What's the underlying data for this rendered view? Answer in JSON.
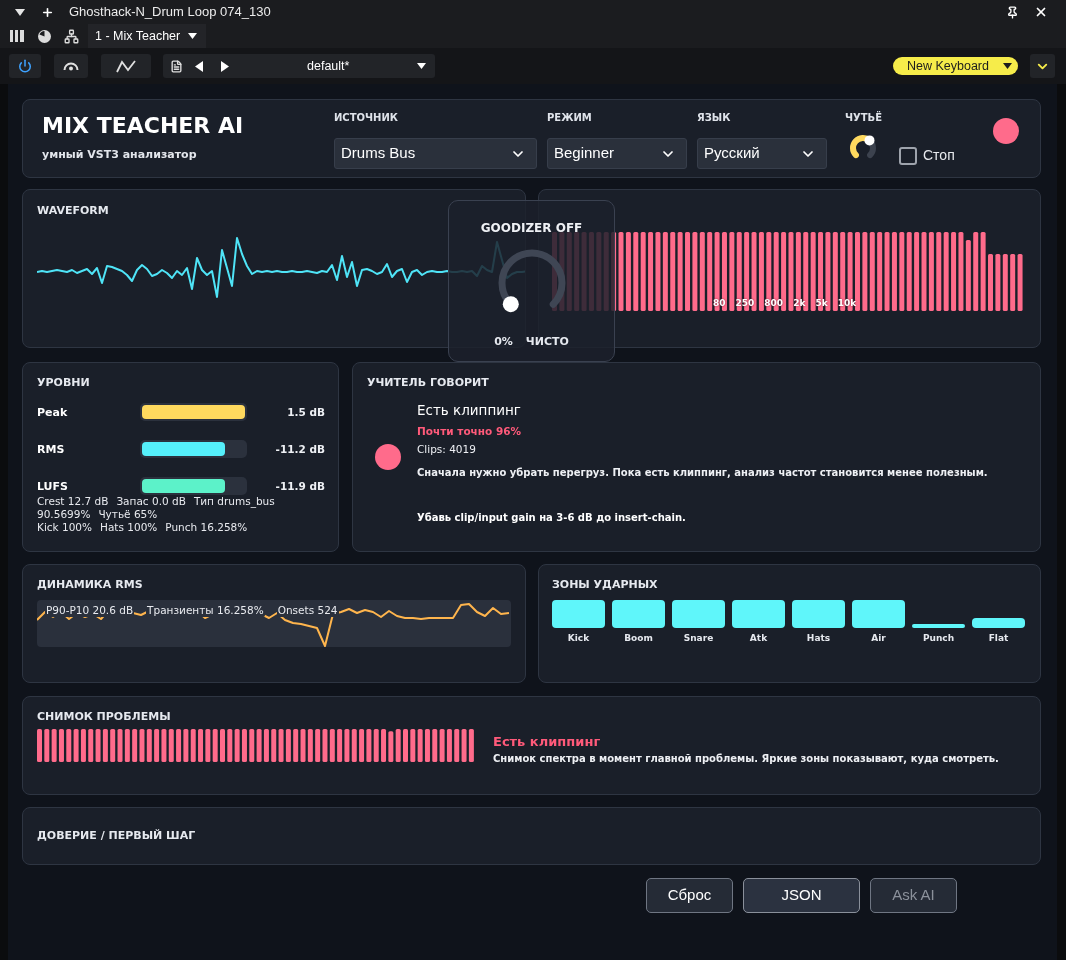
{
  "host": {
    "title": "Ghosthack-N_Drum Loop 074_130",
    "tab": "1 - Mix Teacher",
    "power_on": true,
    "preset": "default*",
    "keyboard": "New Keyboard"
  },
  "header": {
    "title": "MIX TEACHER AI",
    "subtitle": "умный VST3 анализатор",
    "selects": [
      {
        "label": "ИСТОЧНИК",
        "value": "Drums Bus"
      },
      {
        "label": "РЕЖИМ",
        "value": "Beginner"
      },
      {
        "label": "ЯЗЫК",
        "value": "Русский"
      }
    ],
    "sensitivity": {
      "label": "ЧУТЬЁ"
    },
    "stop": {
      "label": "Стоп",
      "checked": false
    }
  },
  "waveform": {
    "title": "WAVEFORM"
  },
  "spectrum": {
    "freq_labels": [
      "80",
      "250",
      "800",
      "2k",
      "5k",
      "10k"
    ]
  },
  "goodizer": {
    "title": "GOODIZER OFF",
    "amount": "0%",
    "mode": "ЧИСТО"
  },
  "levels": {
    "title": "УРОВНИ",
    "meters": [
      {
        "label": "Peak",
        "level": 1,
        "reading": "1.5 dB",
        "color": "#ffd95e"
      },
      {
        "label": "RMS",
        "level": 0.81,
        "reading": "-11.2 dB",
        "color": "#55f0fb"
      },
      {
        "label": "LUFS",
        "level": 0.81,
        "reading": "-11.9 dB",
        "color": "#5cf2c9"
      }
    ],
    "stats": [
      [
        "Crest 12.7 dB",
        "Запас 0.0 dB",
        "Тип drums_bus"
      ],
      [
        "90.5699%",
        "Чутьё 65%"
      ],
      [
        "Kick 100%",
        "Hats 100%",
        "Punch 16.258%"
      ]
    ]
  },
  "teacher": {
    "title": "УЧИТЕЛЬ ГОВОРИТ",
    "heading": "Есть клиппинг",
    "confidence": "Почти точно 96%",
    "clips": "Clips: 4019",
    "explanation": "Сначала нужно убрать перегруз. Пока есть клиппинг, анализ частот становится менее полезным.",
    "action": "Убавь clip/input gain на 3-6 dB до insert-chain."
  },
  "dynamics": {
    "title": "ДИНАМИКА RMS",
    "readout": [
      "P90-P10 20.6 dB",
      "Транзиенты 16.258%",
      "Onsets 524"
    ]
  },
  "zones": {
    "title": "ЗОНЫ УДАРНЫХ",
    "labels": [
      "Kick",
      "Boom",
      "Snare",
      "Atk",
      "Hats",
      "Air",
      "Punch",
      "Flat"
    ]
  },
  "snapshot": {
    "title": "СНИМОК ПРОБЛЕМЫ",
    "heading": "Есть клиппинг",
    "caption": "Снимок спектра в момент главной проблемы. Яркие зоны показывают, куда смотреть."
  },
  "trust": {
    "title": "ДОВЕРИЕ / ПЕРВЫЙ ШАГ"
  },
  "buttons": [
    {
      "label": "Сброс",
      "kind": "secondary",
      "disabled": false
    },
    {
      "label": "JSON",
      "kind": "primary",
      "disabled": false
    },
    {
      "label": "Ask AI",
      "kind": "secondary",
      "disabled": true
    }
  ]
}
